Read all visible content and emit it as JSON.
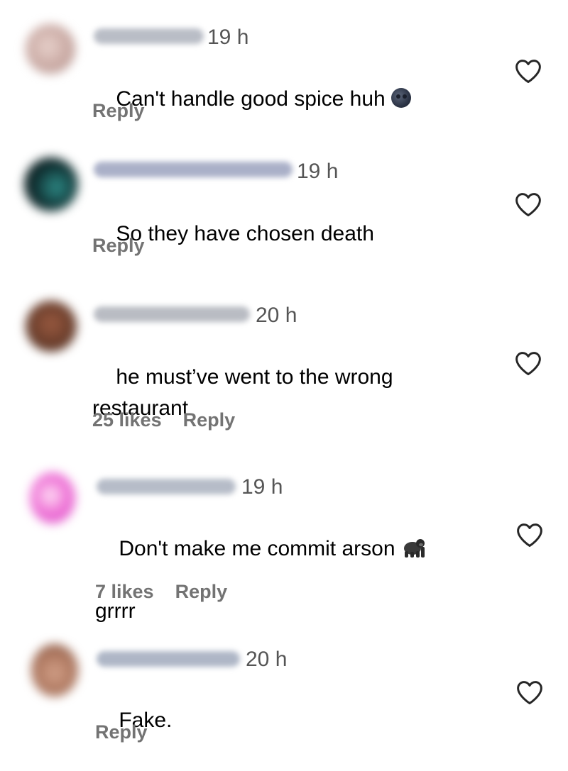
{
  "comments": [
    {
      "time": "19 h",
      "text": "Can't handle good spice huh",
      "emoji": "new-moon-face-emoji",
      "likes": "",
      "reply_label": "Reply",
      "avatar_color": "#c9a9a3",
      "username_color": "#b9bdc6"
    },
    {
      "time": "19 h",
      "text": "So they have chosen death",
      "emoji": "",
      "likes": "",
      "reply_label": "Reply",
      "avatar_color": "#0e2a2c",
      "username_color": "#aab0c8"
    },
    {
      "time": "20 h",
      "text": "he must’ve went to the wrong\nrestaurant",
      "emoji": "",
      "likes": "25 likes",
      "reply_label": "Reply",
      "avatar_color": "#6b3e2c",
      "username_color": "#b9bcc3"
    },
    {
      "time": "19 h",
      "text": "Don't make me commit arson",
      "text_line2": "grrrr",
      "emoji": "gorilla-emoji",
      "likes": "7 likes",
      "reply_label": "Reply",
      "avatar_color": "#f07ad8",
      "username_color": "#b6bcc8"
    },
    {
      "time": "20 h",
      "text": "Fake.",
      "emoji": "",
      "likes": "",
      "reply_label": "Reply",
      "avatar_color": "#b07a62",
      "username_color": "#aeb6c6"
    }
  ],
  "icons": {
    "like": "heart-outline-icon"
  },
  "colors": {
    "meta_text": "#737373",
    "time_text": "#555555",
    "heart_stroke": "#262626"
  }
}
